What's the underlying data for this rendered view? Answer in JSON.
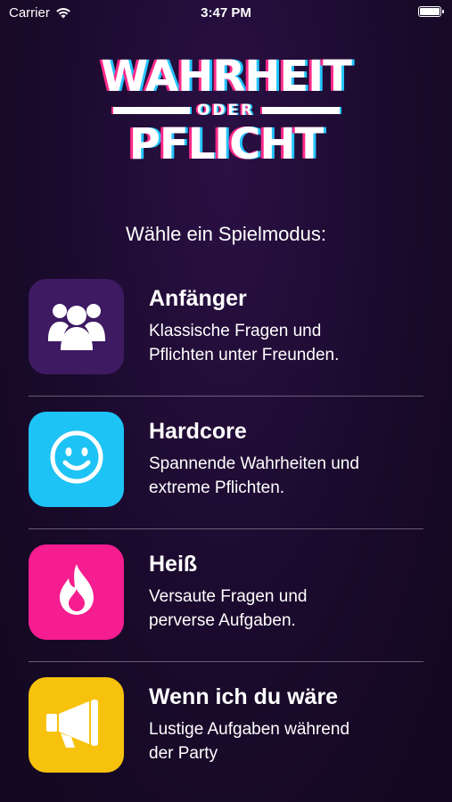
{
  "status_bar": {
    "carrier": "Carrier",
    "time": "3:47 PM",
    "battery_level": 1.0
  },
  "logo": {
    "line1": "WAHRHEIT",
    "middle": "ODER",
    "line2": "PFLICHT"
  },
  "subtitle": "Wähle ein Spielmodus:",
  "modes": [
    {
      "title": "Anfänger",
      "description": "Klassische Fragen und\nPflichten unter Freunden.",
      "icon": "group-icon",
      "color": "#3e1a63"
    },
    {
      "title": "Hardcore",
      "description": "Spannende Wahrheiten und\nextreme Pflichten.",
      "icon": "smiley-icon",
      "color": "#1dc3f5"
    },
    {
      "title": "Heiß",
      "description": "Versaute Fragen und\nperverse Aufgaben.",
      "icon": "flame-icon",
      "color": "#f51d8f"
    },
    {
      "title": "Wenn ich du wäre",
      "description": "Lustige Aufgaben während\nder Party",
      "icon": "megaphone-icon",
      "color": "#f7c20d"
    }
  ]
}
